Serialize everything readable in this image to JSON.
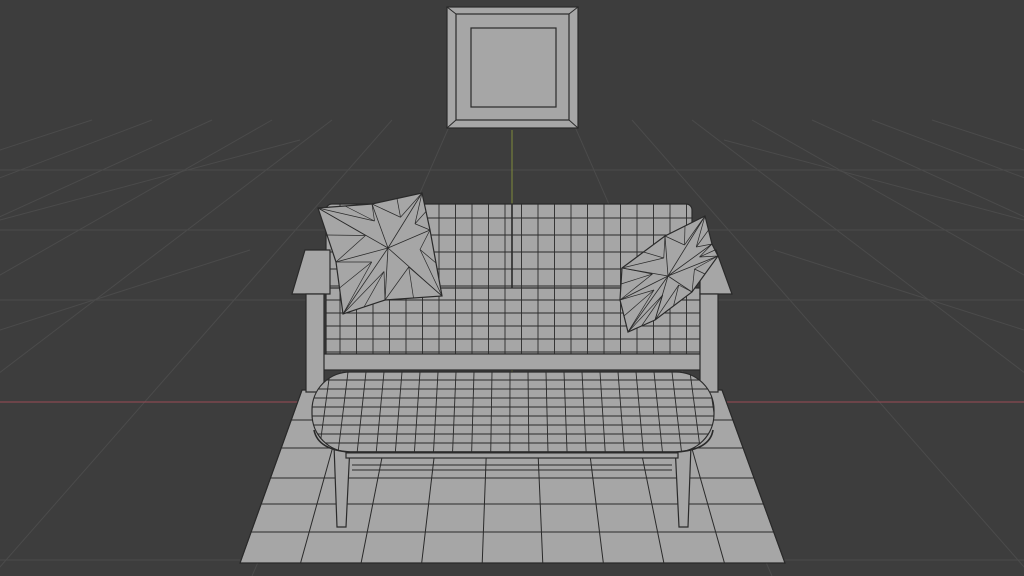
{
  "viewport": {
    "mode": "wireframe",
    "background_color": "#3d3d3d",
    "grid_color": "#4b4b4b",
    "x_axis_color": "#9a4a55",
    "y_axis_color": "#7f8a3a",
    "object_fill_color": "#a6a6a6",
    "edge_color": "#2a2a2a"
  },
  "scene_objects": [
    {
      "name": "wall-frame",
      "type": "mesh"
    },
    {
      "name": "sofa",
      "type": "mesh"
    },
    {
      "name": "pillow-left",
      "type": "mesh"
    },
    {
      "name": "pillow-right",
      "type": "mesh"
    },
    {
      "name": "coffee-table",
      "type": "mesh"
    },
    {
      "name": "rug",
      "type": "mesh"
    }
  ]
}
